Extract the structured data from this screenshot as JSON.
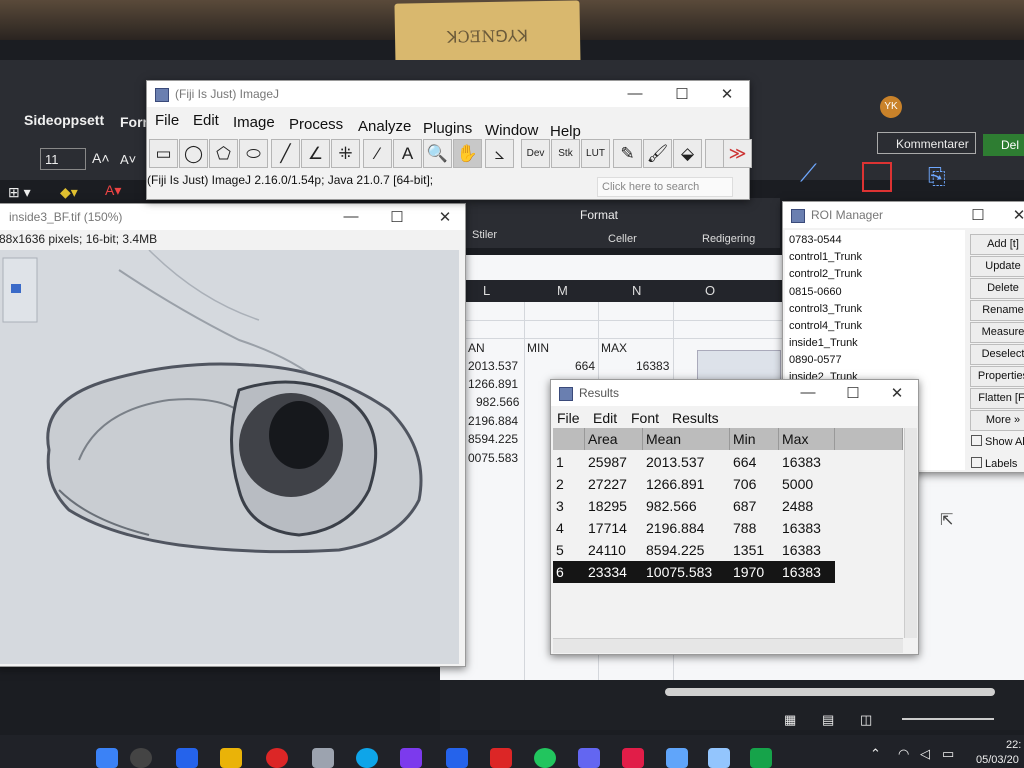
{
  "sticky_note": "ꓘƆƎNꓨ⅄ꓘ",
  "excel": {
    "ribbon": {
      "tab_sideoppsett": "Sideoppsett",
      "tab_form": "Form",
      "font_size": "11",
      "kommentarer": "Kommentarer",
      "del": "Del",
      "stiler": "Stiler",
      "format": "Format",
      "celler": "Celler",
      "redigering": "Redigering",
      "user_initials": "YK"
    },
    "columns": [
      "L",
      "M",
      "N",
      "O"
    ],
    "header_row": [
      "AN",
      "MIN",
      "MAX"
    ],
    "mean_values": [
      "2013.537",
      "1266.891",
      "982.566",
      "2196.884",
      "8594.225",
      "0075.583"
    ],
    "min_values": [
      "664"
    ],
    "max_values": [
      "16383"
    ]
  },
  "imagej": {
    "title": "(Fiji Is Just) ImageJ",
    "menus": [
      "File",
      "Edit",
      "Image",
      "Process",
      "Analyze",
      "Plugins",
      "Window",
      "Help"
    ],
    "tools": [
      "▭",
      "◯",
      "⬠",
      "⬭",
      "╱",
      "∠",
      "⁜",
      "⁄",
      "A",
      "🔍",
      "✋",
      "⦣"
    ],
    "tool_labels": [
      "Dev",
      "Stk",
      "LUT"
    ],
    "status": "(Fiji Is Just) ImageJ 2.16.0/1.54p; Java 21.0.7 [64-bit];",
    "search_placeholder": "Click here to search"
  },
  "image_window": {
    "title": "inside3_BF.tif (150%)",
    "info": "88x1636 pixels; 16-bit; 3.4MB"
  },
  "roi_manager": {
    "title": "ROI Manager",
    "items": [
      "0783-0544",
      "control1_Trunk",
      "control2_Trunk",
      "0815-0660",
      "control3_Trunk",
      "control4_Trunk",
      "inside1_Trunk",
      "0890-0577",
      "inside2_Trunk"
    ],
    "buttons": [
      "Add [t]",
      "Update",
      "Delete",
      "Rename",
      "Measure",
      "Deselect",
      "Properties",
      "Flatten [F]",
      "More »"
    ],
    "checks": [
      "Show All",
      "Labels"
    ]
  },
  "results": {
    "title": "Results",
    "menus": [
      "File",
      "Edit",
      "Font",
      "Results"
    ],
    "columns": [
      "",
      "Area",
      "Mean",
      "Min",
      "Max"
    ],
    "rows": [
      [
        "1",
        "25987",
        "2013.537",
        "664",
        "16383"
      ],
      [
        "2",
        "27227",
        "1266.891",
        "706",
        "5000"
      ],
      [
        "3",
        "18295",
        "982.566",
        "687",
        "2488"
      ],
      [
        "4",
        "17714",
        "2196.884",
        "788",
        "16383"
      ],
      [
        "5",
        "24110",
        "8594.225",
        "1351",
        "16383"
      ],
      [
        "6",
        "23334",
        "10075.583",
        "1970",
        "16383"
      ]
    ],
    "selected_row": 6
  },
  "taskbar": {
    "clock_time": "22:",
    "clock_date": "05/03/20"
  }
}
